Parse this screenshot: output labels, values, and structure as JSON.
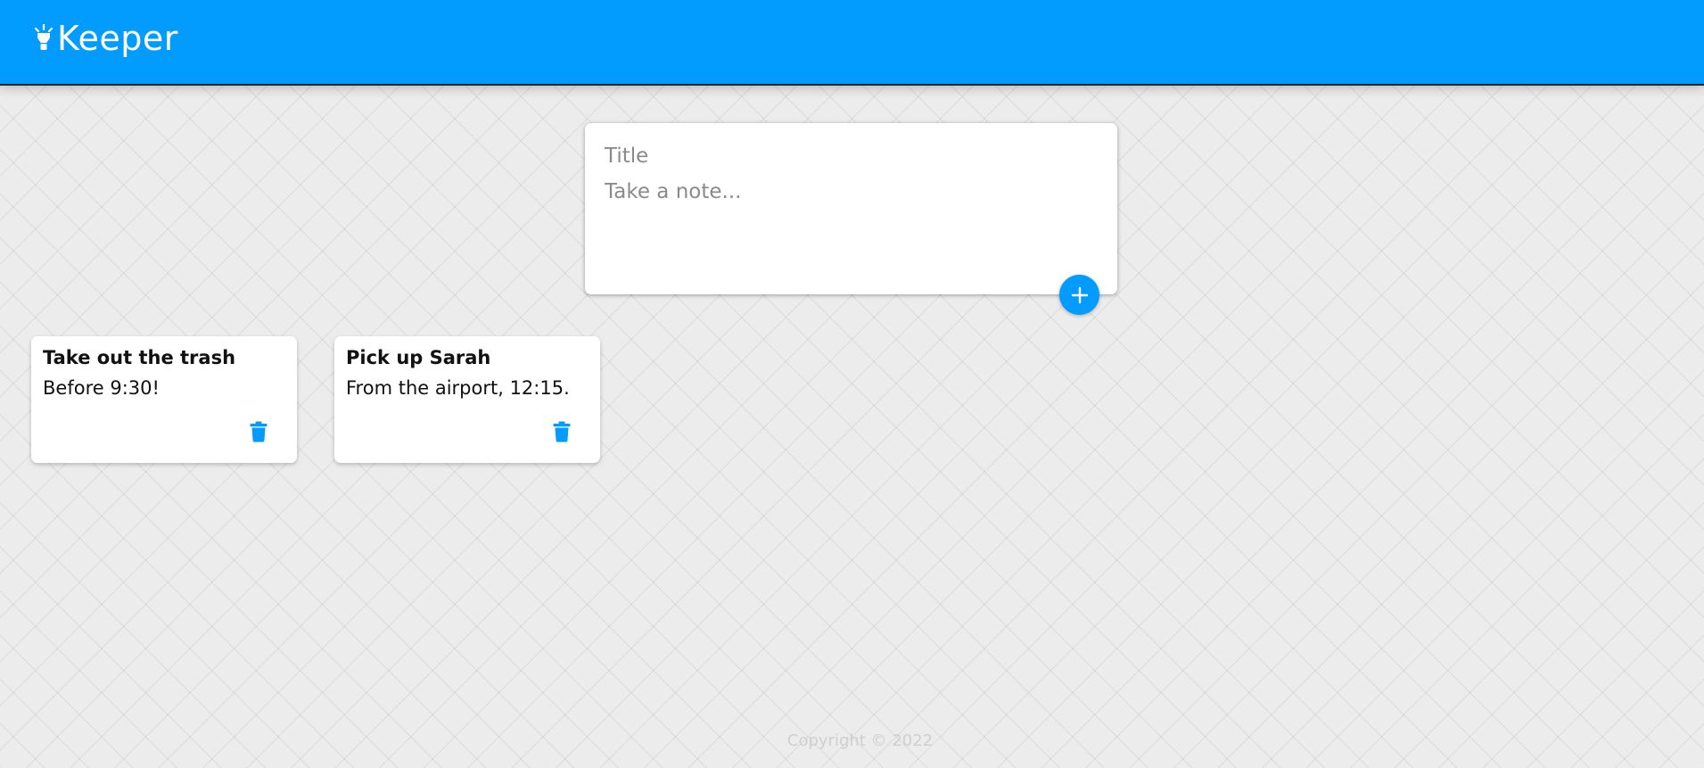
{
  "header": {
    "brand_icon": "lightbulb-icon",
    "brand_title": "Keeper",
    "background_color": "#029bff"
  },
  "composer": {
    "title_placeholder": "Title",
    "title_value": "",
    "content_placeholder": "Take a note...",
    "content_value": "",
    "add_icon": "plus-icon",
    "accent_color": "#029bff"
  },
  "notes": [
    {
      "title": "Take out the trash",
      "content": "Before 9:30!",
      "delete_icon": "trash-icon"
    },
    {
      "title": "Pick up Sarah",
      "content": "From the airport, 12:15.",
      "delete_icon": "trash-icon"
    }
  ],
  "footer": {
    "text": "Copyright © 2022"
  }
}
